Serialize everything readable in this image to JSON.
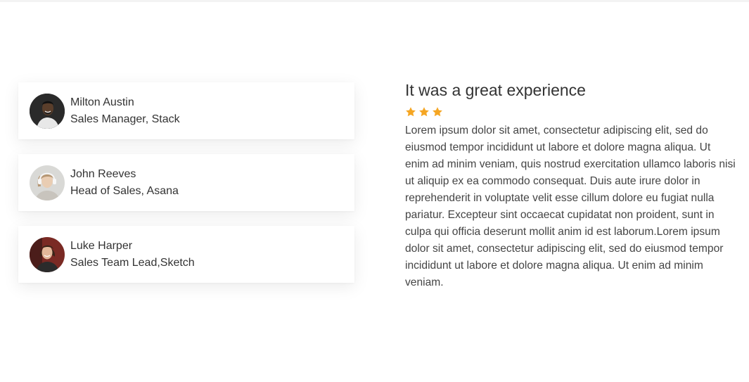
{
  "testimonials": [
    {
      "name": "Milton Austin",
      "role": "Sales Manager, Stack",
      "avatar_icon": "man-portrait-avatar"
    },
    {
      "name": "John Reeves",
      "role": "Head of Sales, Asana",
      "avatar_icon": "woman-headphones-avatar"
    },
    {
      "name": "Luke Harper",
      "role": "Sales Team Lead,Sketch",
      "avatar_icon": "woman-smiling-avatar"
    }
  ],
  "review": {
    "title": "It was a great experience",
    "rating": 3,
    "star_color": "#F5A623",
    "body": "Lorem ipsum dolor sit amet, consectetur adipiscing elit, sed do eiusmod tempor incididunt ut labore et dolore magna aliqua. Ut enim ad minim veniam, quis nostrud exercitation ullamco laboris nisi ut aliquip ex ea commodo consequat. Duis aute irure dolor in reprehenderit in voluptate velit esse cillum dolore eu fugiat nulla pariatur. Excepteur sint occaecat cupidatat non proident, sunt in culpa qui officia deserunt mollit anim id est laborum.Lorem ipsum dolor sit amet, consectetur adipiscing elit, sed do eiusmod tempor incididunt ut labore et dolore magna aliqua. Ut enim ad minim veniam."
  }
}
